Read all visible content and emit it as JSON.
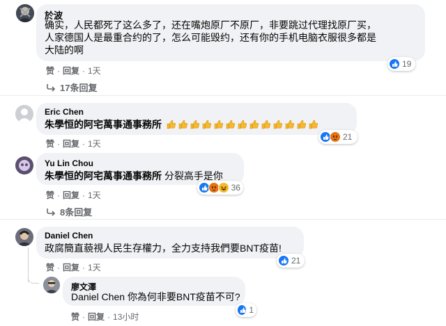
{
  "comments": [
    {
      "author": "於波",
      "lines": [
        "确实，人民都死了这么多了，还在嘴炮原厂不原厂，非要跳过代理找原厂买，",
        "人家德国人是最重合约的了，怎么可能毁约，还有你的手机电脑衣服很多都是",
        "大陆的啊"
      ],
      "like_label": "赞",
      "reply_label": "回复",
      "time": "1天",
      "reaction_count": "19",
      "replies_link": "17条回复"
    },
    {
      "author": "Eric Chen",
      "mention": "朱學恒的阿宅萬事通事務所",
      "thumbs_count": 13,
      "like_label": "赞",
      "reply_label": "回复",
      "time": "1天",
      "reaction_count": "21"
    },
    {
      "author": "Yu Lin Chou",
      "mention": "朱學恒的阿宅萬事通事務所",
      "text": " 分裂高手是你",
      "like_label": "赞",
      "reply_label": "回复",
      "time": "1天",
      "reaction_count": "36",
      "replies_link": "8条回复"
    },
    {
      "author": "Daniel Chen",
      "text": "政腐簡直藐視人民生存權力，全力支持我們要BNT疫苗!",
      "like_label": "赞",
      "reply_label": "回复",
      "time": "1天",
      "reaction_count": "21"
    },
    {
      "author": "廖文澤",
      "text": "Daniel Chen 你為何非要BNT疫苗不可?",
      "like_label": "赞",
      "reply_label": "回复",
      "time": "13小时",
      "reaction_count": "1"
    }
  ],
  "icons": {
    "like": "thumbs-up-icon",
    "haha": "laughing-face-icon",
    "angry": "angry-face-icon",
    "reply_arrow": "reply-arrow-icon",
    "emoji": "thumbs-up-emoji-icon"
  },
  "colors": {
    "bubble": "#f0f2f5",
    "like_blue": "#1877f2",
    "meta_gray": "#65676b"
  }
}
